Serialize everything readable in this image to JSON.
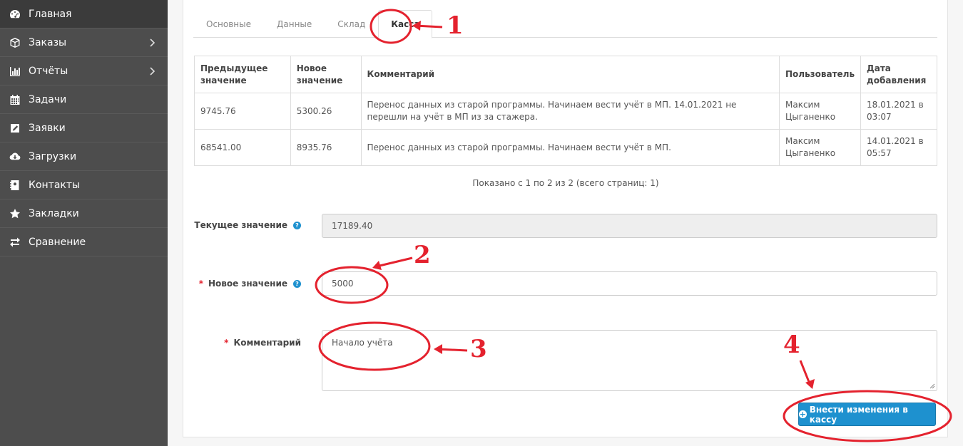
{
  "sidebar": {
    "items": [
      {
        "label": "Главная",
        "icon": "dashboard-icon",
        "has_submenu": false,
        "active": true
      },
      {
        "label": "Заказы",
        "icon": "cube-icon",
        "has_submenu": true
      },
      {
        "label": "Отчёты",
        "icon": "bar-chart-icon",
        "has_submenu": true
      },
      {
        "label": "Задачи",
        "icon": "calendar-icon",
        "has_submenu": false
      },
      {
        "label": "Заявки",
        "icon": "edit-icon",
        "has_submenu": false
      },
      {
        "label": "Загрузки",
        "icon": "cloud-download-icon",
        "has_submenu": false
      },
      {
        "label": "Контакты",
        "icon": "address-book-icon",
        "has_submenu": false
      },
      {
        "label": "Закладки",
        "icon": "star-icon",
        "has_submenu": false
      },
      {
        "label": "Сравнение",
        "icon": "exchange-icon",
        "has_submenu": false
      }
    ]
  },
  "tabs": [
    {
      "label": "Основные"
    },
    {
      "label": "Данные"
    },
    {
      "label": "Склад"
    },
    {
      "label": "Касса",
      "active": true
    }
  ],
  "history_table": {
    "headers": [
      "Предыдущее значение",
      "Новое значение",
      "Комментарий",
      "Пользователь",
      "Дата добавления"
    ],
    "rows": [
      {
        "prev": "9745.76",
        "new": "5300.26",
        "comment": "Перенос данных из старой программы. Начинаем вести учёт в МП. 14.01.2021 не перешли на учёт в МП из за стажера.",
        "user": "Максим Цыганенко",
        "date": "18.01.2021 в 03:07"
      },
      {
        "prev": "68541.00",
        "new": "8935.76",
        "comment": "Перенос данных из старой программы. Начинаем вести учёт в МП.",
        "user": "Максим Цыганенко",
        "date": "14.01.2021 в 05:57"
      }
    ]
  },
  "pagination": {
    "text": "Показано с 1 по 2 из 2 (всего страниц: 1)"
  },
  "form": {
    "current_value": {
      "label": "Текущее значение",
      "value": "17189.40"
    },
    "new_value": {
      "label": "Новое значение",
      "required_mark": "*",
      "value": "5000"
    },
    "comment": {
      "label": "Комментарий",
      "required_mark": "*",
      "value": "Начало учёта"
    },
    "submit_label": "Внести изменения в кассу"
  },
  "annotations": {
    "step1": "1",
    "step2": "2",
    "step3": "3",
    "step4": "4",
    "color": "#e4222e"
  },
  "colors": {
    "sidebar_bg": "#4d4d4d",
    "primary_button": "#1e91cf",
    "required": "#e4222e"
  }
}
